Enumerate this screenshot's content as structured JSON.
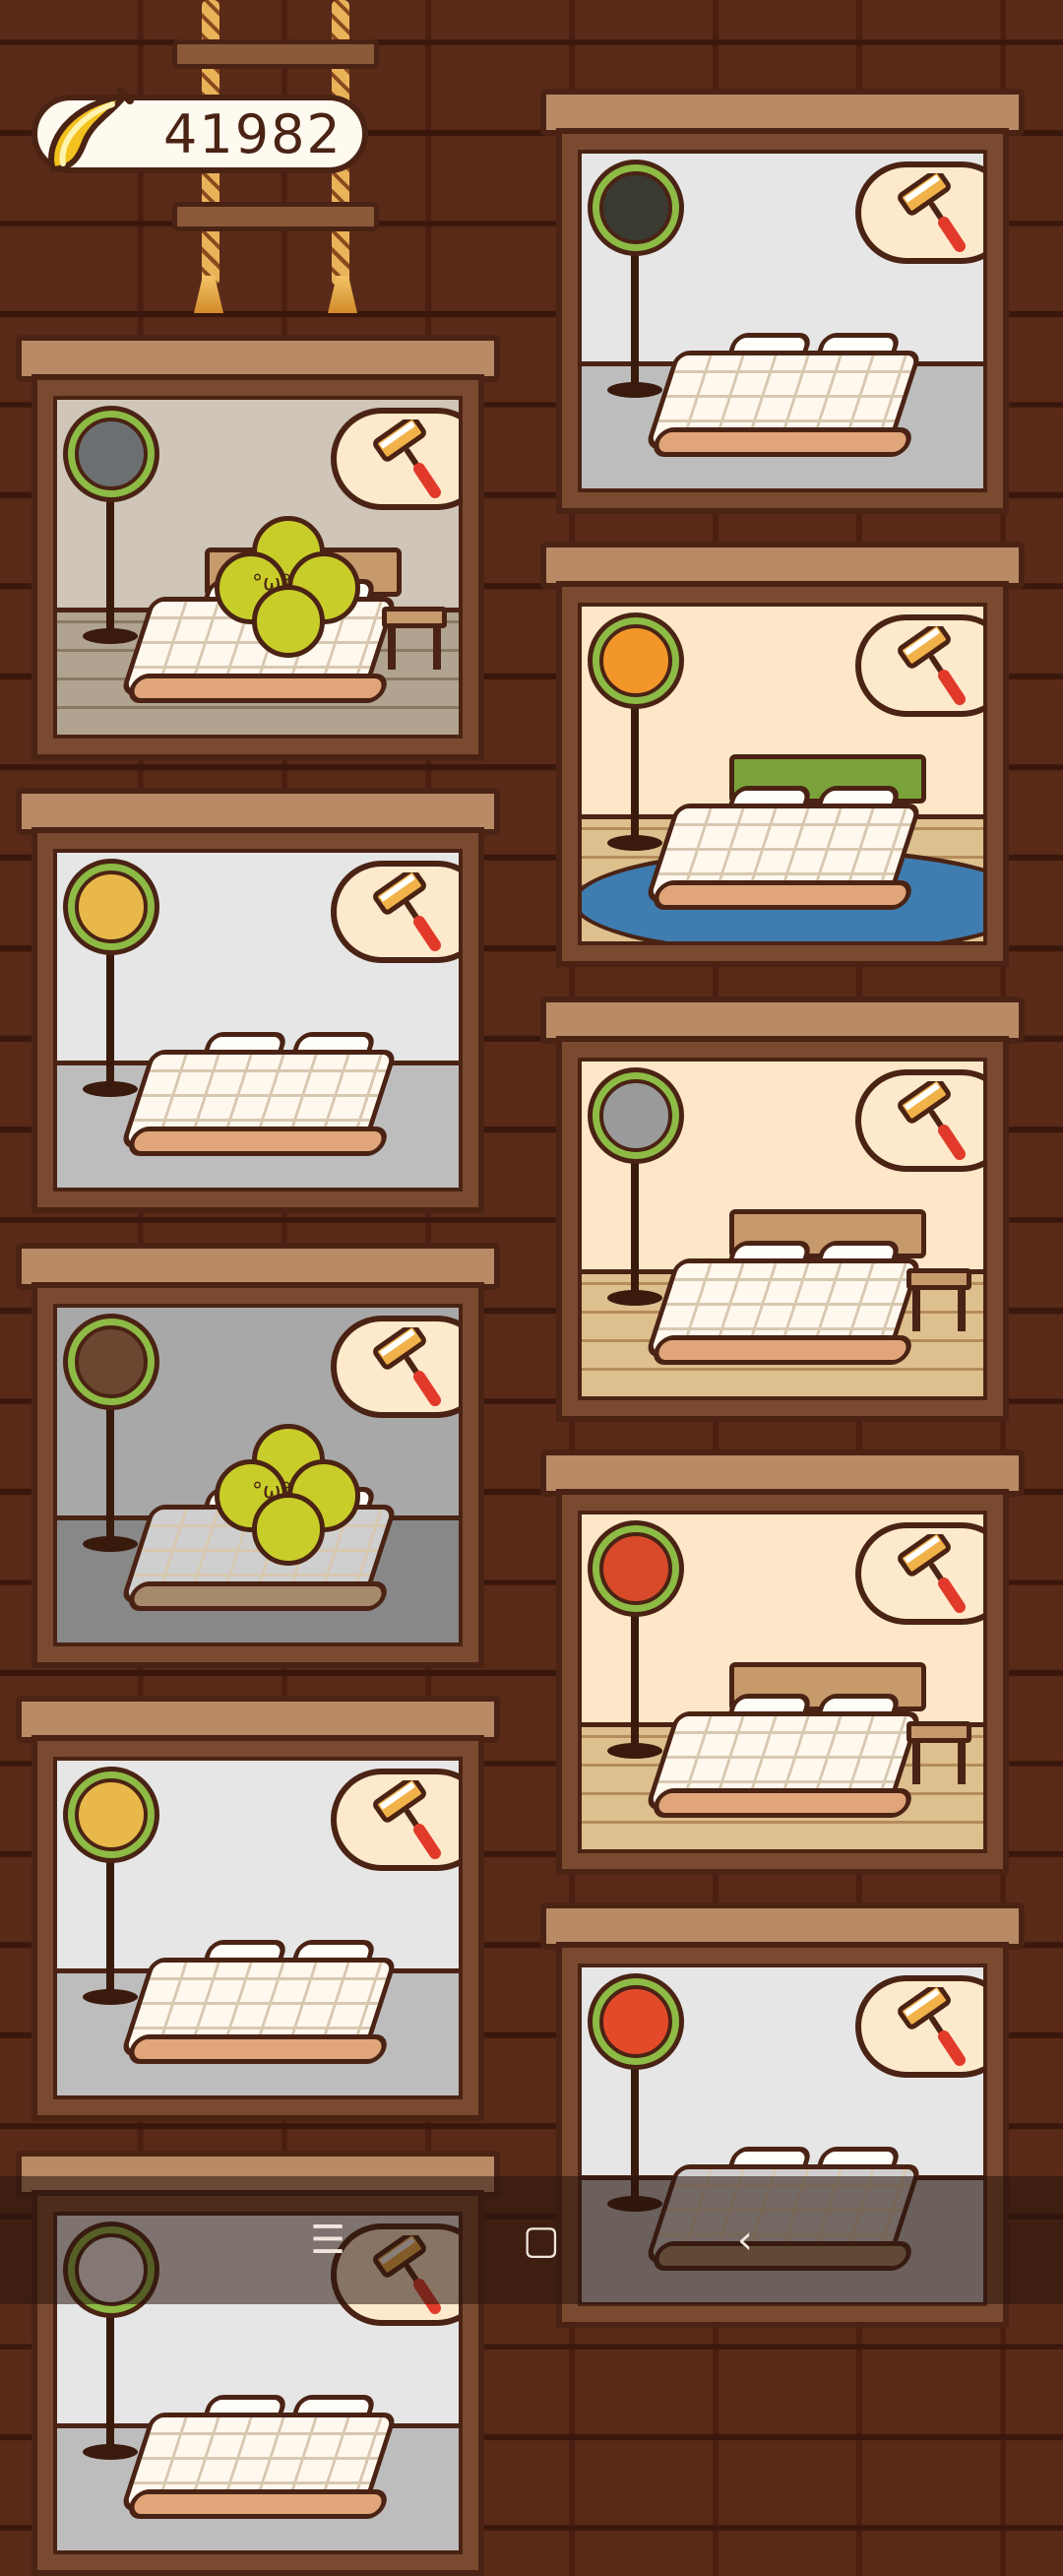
{
  "currency": {
    "amount": "41982",
    "icon": "banana-icon",
    "color": "#f3c21e"
  },
  "rooms_left": [
    {
      "id": "l1",
      "avatar": "robot-avatar",
      "face": "#6c6f72",
      "wall": "taupe",
      "floor": "taupe",
      "bed": "framed",
      "guest": "clover",
      "stool": true
    },
    {
      "id": "l2",
      "avatar": "dog-avatar",
      "face": "#e8b84a",
      "wall": "grey",
      "floor": "grey",
      "bed": "basic"
    },
    {
      "id": "l3",
      "avatar": "bat-avatar",
      "face": "#6b4630",
      "wall": "dim",
      "floor": "dim",
      "bed": "basic-dim",
      "guest": "clover"
    },
    {
      "id": "l4",
      "avatar": "lion-avatar",
      "face": "#e9b84a",
      "wall": "grey",
      "floor": "grey",
      "bed": "basic"
    },
    {
      "id": "l5",
      "avatar": "rabbit-avatar",
      "face": "#f2f2f2",
      "wall": "grey",
      "floor": "grey",
      "bed": "basic"
    }
  ],
  "rooms_right": [
    {
      "id": "r1",
      "avatar": "mole-avatar",
      "face": "#3a3a32",
      "wall": "grey",
      "floor": "grey",
      "bed": "basic"
    },
    {
      "id": "r2",
      "avatar": "orange-avatar",
      "face": "#f2962a",
      "wall": "cream",
      "floor": "wood",
      "bed": "green",
      "rug": true
    },
    {
      "id": "r3",
      "avatar": "raccoon-avatar",
      "face": "#9a9a9a",
      "wall": "cream",
      "floor": "wood",
      "bed": "framed",
      "stool": true
    },
    {
      "id": "r4",
      "avatar": "bird-avatar",
      "face": "#d84a2a",
      "wall": "cream",
      "floor": "wood",
      "bed": "framed",
      "stool": true
    },
    {
      "id": "r5",
      "avatar": "burger-avatar",
      "face": "#e24a2a",
      "wall": "grey",
      "floor": "grey",
      "bed": "basic-dim"
    }
  ],
  "guest_text": "°ω°",
  "clean_icon": "roller-brush-icon",
  "navbar": {
    "menu": "☰",
    "home": "▢",
    "back": "‹"
  }
}
